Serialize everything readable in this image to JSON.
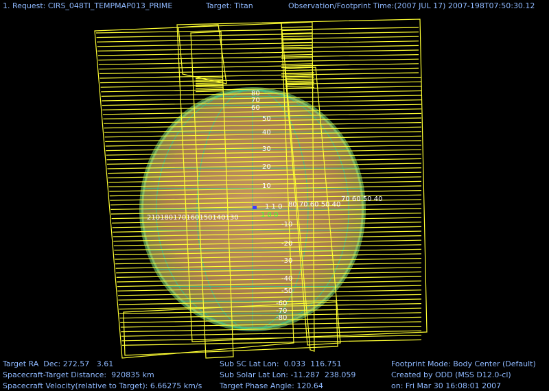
{
  "header": {
    "request": "1. Request: CIRS_048TI_TEMPMAP013_PRIME",
    "target": "Target: Titan",
    "obs_time": "Observation/Footprint Time:(2007 JUL 17) 2007-198T07:50:30.12"
  },
  "footer": {
    "left": [
      "Target RA  Dec: 272.57   3.61",
      "Spacecraft-Target Distance:  920835 km",
      "Spacecraft Velocity(relative to Target): 6.66275 km/s"
    ],
    "middle": [
      "Sub SC Lat Lon:  0.033  116.751",
      "Sub Solar Lat Lon: -11.287  238.059",
      "Target Phase Angle: 120.64"
    ],
    "right": [
      "Footprint Mode: Body Center (Default)",
      "Created by ODD (MSS D12.0-cl)",
      "on: Fri Mar 30 16:08:01 2007"
    ]
  },
  "grid_labels": {
    "lat_north": [
      "80",
      "70",
      "60",
      "50",
      "40",
      "30",
      "20",
      "10"
    ],
    "lat_south": [
      "-10",
      "-20",
      "-30",
      "-40",
      "-50",
      "-60",
      "-70",
      "-80"
    ],
    "lon_left": "210180170160150140130",
    "lon_right": "80  70  60  50  40",
    "lon_right_far": "70  60 50 40",
    "center_left": "1 1 0",
    "center_right": "1 0 0"
  },
  "colors": {
    "background": "#000000",
    "text": "#8fb9ff",
    "footprint": "#ffff33",
    "grid": "#39ff39",
    "planet": "#c9925a"
  }
}
